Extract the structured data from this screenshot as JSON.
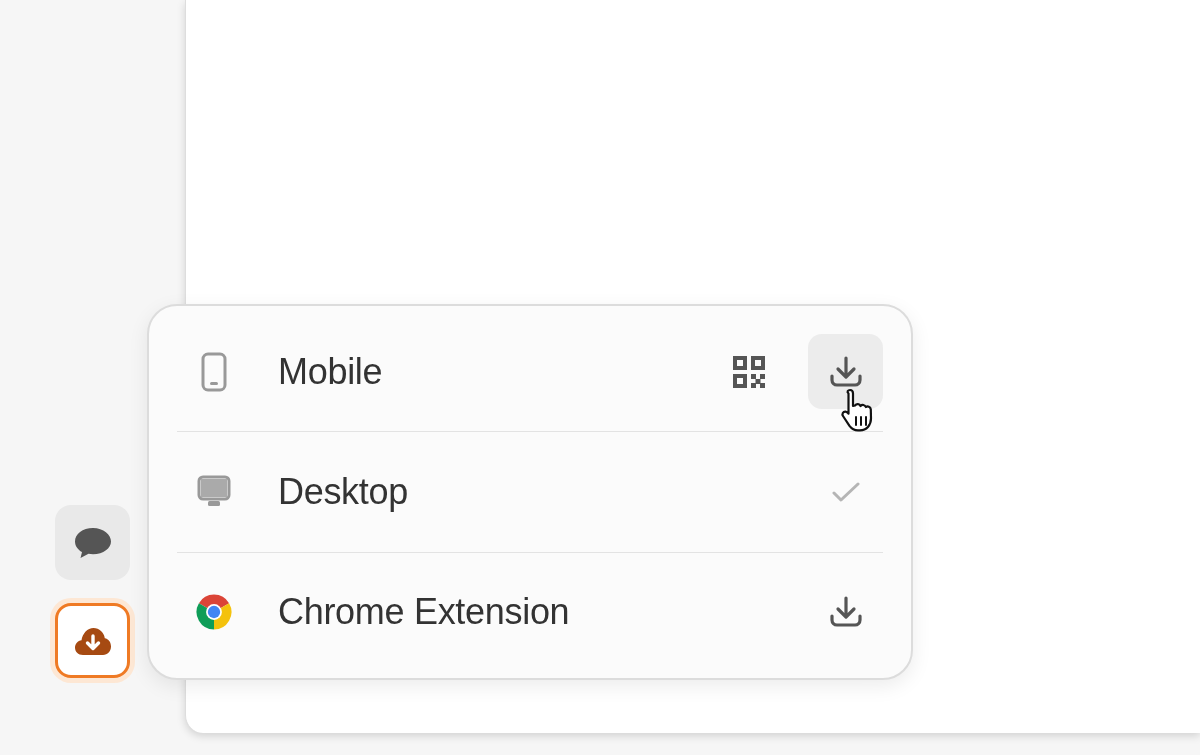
{
  "rail": [
    {
      "kind": "chat",
      "selected": false
    },
    {
      "kind": "cloud-download",
      "selected": true
    }
  ],
  "download_menu": {
    "rows": [
      {
        "kind": "mobile",
        "label": "Mobile",
        "actions": [
          {
            "kind": "qr",
            "hovered": false
          },
          {
            "kind": "download",
            "hovered": true
          }
        ]
      },
      {
        "kind": "desktop",
        "label": "Desktop",
        "actions": [
          {
            "kind": "check"
          }
        ]
      },
      {
        "kind": "chrome",
        "label": "Chrome Extension",
        "actions": [
          {
            "kind": "download",
            "hovered": false
          }
        ]
      }
    ]
  }
}
